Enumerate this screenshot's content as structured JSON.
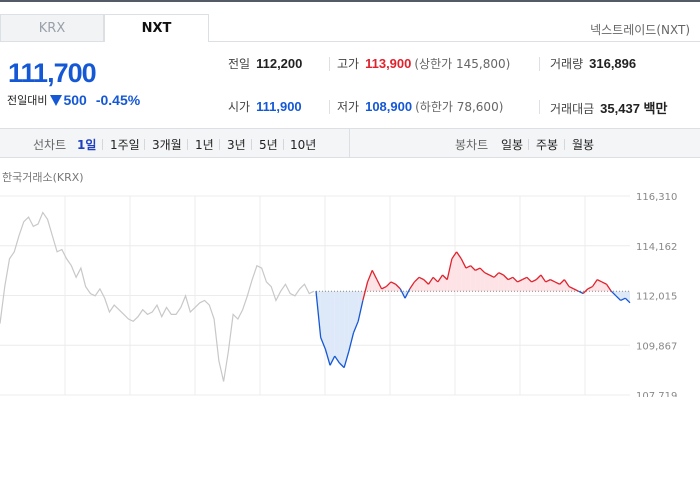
{
  "tabs": [
    {
      "label": "KRX",
      "active": false
    },
    {
      "label": "NXT",
      "active": true
    }
  ],
  "exchange_label": "넥스트레이드(NXT)",
  "price": {
    "current": "111,700",
    "change_label": "전일대비",
    "change_value": "500",
    "change_direction": "down",
    "change_percent": "-0.45%"
  },
  "stats": {
    "prev_close": {
      "label": "전일",
      "value": "112,200"
    },
    "high": {
      "label": "고가",
      "value": "113,900",
      "note": "(상한가 145,800)"
    },
    "volume": {
      "label": "거래량",
      "value": "316,896"
    },
    "open": {
      "label": "시가",
      "value": "111,900"
    },
    "low": {
      "label": "저가",
      "value": "108,900",
      "note": "(하한가 78,600)"
    },
    "amount": {
      "label": "거래대금",
      "value": "35,437 백만"
    }
  },
  "toolbar": {
    "line_chart_label": "선차트",
    "line_periods": [
      "1일",
      "1주일",
      "3개월",
      "1년",
      "3년",
      "5년",
      "10년"
    ],
    "active_period": "1일",
    "candle_chart_label": "봉차트",
    "candle_periods": [
      "일봉",
      "주봉",
      "월봉"
    ]
  },
  "chart_title": "한국거래소(KRX)",
  "colors": {
    "up": "#e0222d",
    "down": "#1558d6",
    "krx_line": "#c8c8c8",
    "up_fill": "#fde3e5",
    "down_fill": "#dde8f8"
  },
  "chart_data": {
    "type": "line",
    "reference_price": 112200,
    "ylim": [
      107719,
      116310
    ],
    "y_ticks": [
      "116,310",
      "114,162",
      "112,015",
      "109,867",
      "107,719"
    ],
    "series": [
      {
        "name": "한국거래소(KRX)",
        "values": [
          110800,
          112400,
          113600,
          113900,
          114600,
          115200,
          115400,
          115000,
          115100,
          115600,
          115300,
          114600,
          113900,
          114000,
          113600,
          113300,
          112800,
          113200,
          112400,
          112100,
          112000,
          112300,
          111900,
          111300,
          111600,
          111400,
          111200,
          111000,
          110900,
          111100,
          111400,
          111200,
          111300,
          111600,
          111100,
          111500,
          111200,
          111200,
          111500,
          112000,
          111300,
          111500,
          111700,
          111800,
          111600,
          111000,
          109200,
          108300,
          109600,
          111200,
          111000,
          111400,
          112000,
          112700,
          113300,
          113200,
          112600,
          112400,
          111800,
          112200,
          112500,
          112100,
          112000,
          112300,
          112500,
          112100,
          112200
        ]
      },
      {
        "name": "NXT",
        "values": [
          112200,
          110200,
          109700,
          109000,
          109400,
          109100,
          108900,
          109600,
          110400,
          110900,
          111800,
          112600,
          113100,
          112700,
          112300,
          112400,
          112600,
          112500,
          112300,
          111900,
          112300,
          112600,
          112800,
          112700,
          112500,
          112800,
          112600,
          112900,
          112700,
          113600,
          113900,
          113600,
          113200,
          113300,
          113100,
          113200,
          113000,
          112900,
          112800,
          113000,
          112900,
          112700,
          112800,
          112600,
          112700,
          112800,
          112600,
          112700,
          112900,
          112600,
          112700,
          112600,
          112500,
          112700,
          112400,
          112300,
          112200,
          112100,
          112300,
          112400,
          112700,
          112600,
          112500,
          112200,
          112000,
          111800,
          111900,
          111700
        ]
      }
    ]
  }
}
